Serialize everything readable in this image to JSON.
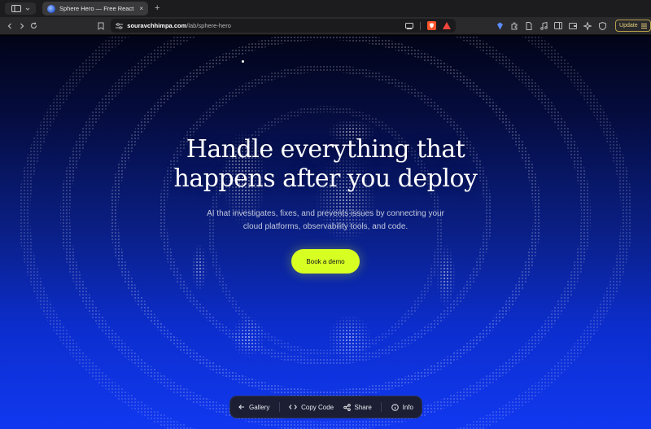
{
  "browser": {
    "tab_title": "Sphere Hero — Free React Co",
    "new_tab": "+",
    "tab_close": "×",
    "url_domain": "souravchhimpa.com",
    "url_path": "/lab/sphere-hero",
    "update_label": "Update"
  },
  "hero": {
    "headline_line1": "Handle everything that",
    "headline_line2": "happens after you deploy",
    "subtext_line1": "AI that investigates, fixes, and prevents issues by connecting your",
    "subtext_line2": "cloud platforms, observability tools, and code.",
    "cta_label": "Book a demo"
  },
  "dock": {
    "items": [
      {
        "label": "Gallery",
        "icon": "arrow-left-icon"
      },
      {
        "label": "Copy Code",
        "icon": "code-icon"
      },
      {
        "label": "Share",
        "icon": "share-icon"
      },
      {
        "label": "Info",
        "icon": "info-icon"
      }
    ]
  },
  "colors": {
    "cta": "#d8ff22",
    "background_top": "#020418",
    "background_bottom": "#1138f0"
  }
}
